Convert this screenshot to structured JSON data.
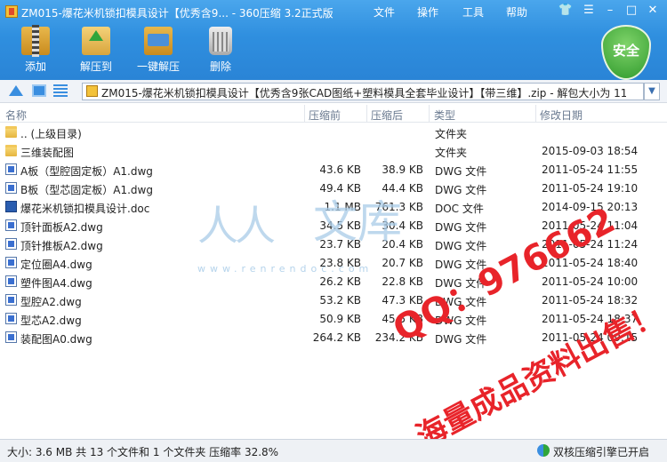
{
  "window": {
    "title": "ZM015-爆花米机锁扣模具设计【优秀含9... - 360压缩 3.2正式版",
    "menu": [
      "文件",
      "操作",
      "工具",
      "帮助"
    ]
  },
  "toolbar": {
    "add_label": "添加",
    "extract_label": "解压到",
    "one_click_label": "一键解压",
    "delete_label": "删除",
    "security_label": "安全"
  },
  "address": {
    "path": "ZM015-爆花米机锁扣模具设计【优秀含9张CAD图纸+塑料模具全套毕业设计】【带三维】.zip - 解包大小为 11"
  },
  "columns": {
    "name": "名称",
    "size": "压缩前",
    "compressed": "压缩后",
    "type": "类型",
    "modified": "修改日期"
  },
  "files": [
    {
      "icon": "folder",
      "name": ".. (上级目录)",
      "size": "",
      "compressed": "",
      "type": "文件夹",
      "date": ""
    },
    {
      "icon": "folder",
      "name": "三维装配图",
      "size": "",
      "compressed": "",
      "type": "文件夹",
      "date": "2015-09-03 18:54"
    },
    {
      "icon": "dwg",
      "name": "A板（型腔固定板）A1.dwg",
      "size": "43.6 KB",
      "compressed": "38.9 KB",
      "type": "DWG 文件",
      "date": "2011-05-24 11:55"
    },
    {
      "icon": "dwg",
      "name": "B板（型芯固定板）A1.dwg",
      "size": "49.4 KB",
      "compressed": "44.4 KB",
      "type": "DWG 文件",
      "date": "2011-05-24 19:10"
    },
    {
      "icon": "doc",
      "name": "爆花米机锁扣模具设计.doc",
      "size": "1.1 MB",
      "compressed": "761.3 KB",
      "type": "DOC 文件",
      "date": "2014-09-15 20:13"
    },
    {
      "icon": "dwg",
      "name": "顶针面板A2.dwg",
      "size": "34.5 KB",
      "compressed": "30.4 KB",
      "type": "DWG 文件",
      "date": "2011-05-24 11:04"
    },
    {
      "icon": "dwg",
      "name": "顶针推板A2.dwg",
      "size": "23.7 KB",
      "compressed": "20.4 KB",
      "type": "DWG 文件",
      "date": "2011-05-24 11:24"
    },
    {
      "icon": "dwg",
      "name": "定位圈A4.dwg",
      "size": "23.8 KB",
      "compressed": "20.7 KB",
      "type": "DWG 文件",
      "date": "2011-05-24 18:40"
    },
    {
      "icon": "dwg",
      "name": "塑件图A4.dwg",
      "size": "26.2 KB",
      "compressed": "22.8 KB",
      "type": "DWG 文件",
      "date": "2011-05-24 10:00"
    },
    {
      "icon": "dwg",
      "name": "型腔A2.dwg",
      "size": "53.2 KB",
      "compressed": "47.3 KB",
      "type": "DWG 文件",
      "date": "2011-05-24 18:32"
    },
    {
      "icon": "dwg",
      "name": "型芯A2.dwg",
      "size": "50.9 KB",
      "compressed": "45.5 KB",
      "type": "DWG 文件",
      "date": "2011-05-24 18:37"
    },
    {
      "icon": "dwg",
      "name": "装配图A0.dwg",
      "size": "264.2 KB",
      "compressed": "234.2 KB",
      "type": "DWG 文件",
      "date": "2011-05-24 09:15"
    }
  ],
  "watermark": {
    "ren": "人人",
    "wen": "文库",
    "url": "www.renrendoc.com",
    "qq": "QQ：976662",
    "sell": "海量成品资料出售！"
  },
  "status": {
    "left": "大小: 3.6 MB 共 13 个文件和 1 个文件夹 压缩率 32.8%",
    "right": "双核压缩引擎已开启"
  }
}
